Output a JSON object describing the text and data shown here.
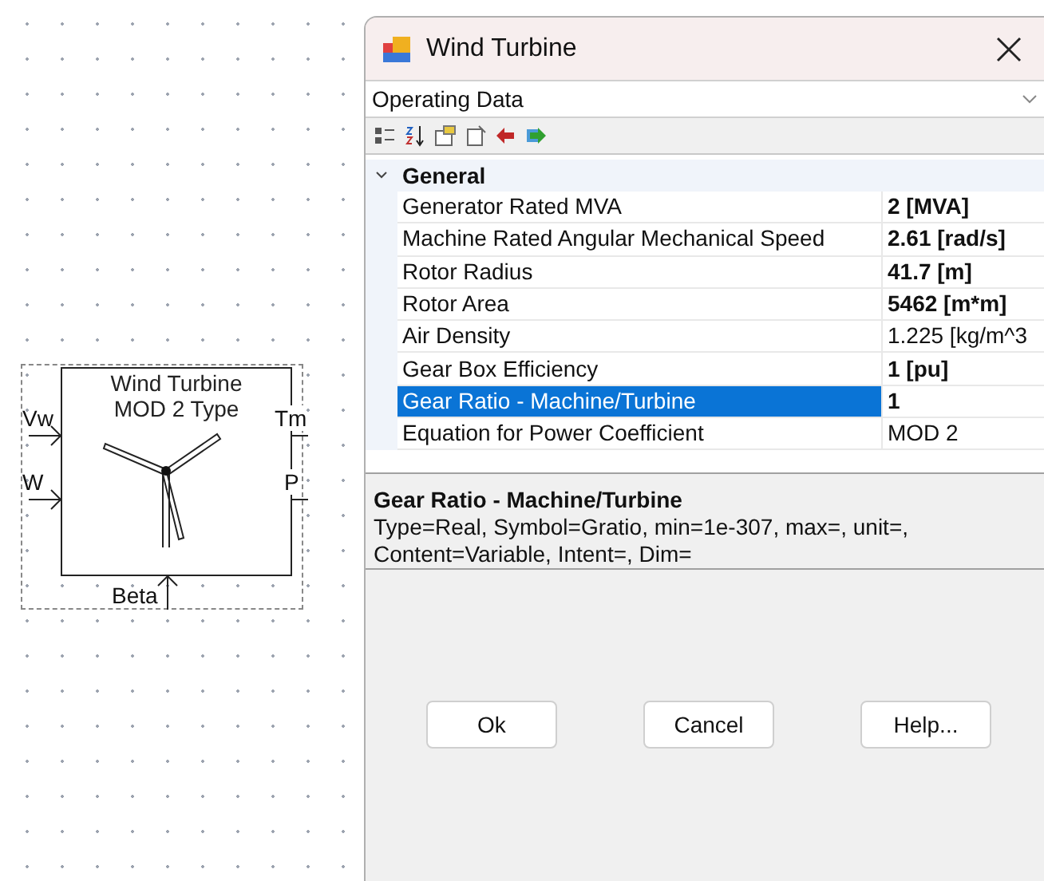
{
  "block": {
    "title_lines": [
      "Wind Turbine",
      "MOD 2 Type"
    ],
    "inputs": [
      "Vw",
      "W"
    ],
    "outputs": [
      "Tm",
      "P"
    ],
    "bottom_input": "Beta",
    "selected": true
  },
  "window": {
    "title": "Wind Turbine"
  },
  "category_select": {
    "value": "Operating Data"
  },
  "group": {
    "label": "General",
    "expanded": true
  },
  "properties": [
    {
      "name": "Generator Rated MVA",
      "value": "2 [MVA]",
      "bold": true,
      "selected": false
    },
    {
      "name": "Machine Rated Angular Mechanical Speed",
      "value": "2.61 [rad/s]",
      "bold": true,
      "selected": false
    },
    {
      "name": "Rotor Radius",
      "value": "41.7 [m]",
      "bold": true,
      "selected": false
    },
    {
      "name": "Rotor Area",
      "value": "5462 [m*m]",
      "bold": true,
      "selected": false
    },
    {
      "name": "Air Density",
      "value": "1.225 [kg/m^3",
      "bold": false,
      "selected": false
    },
    {
      "name": "Gear Box Efficiency",
      "value": "1 [pu]",
      "bold": true,
      "selected": false
    },
    {
      "name": "Gear Ratio - Machine/Turbine",
      "value": "1",
      "bold": true,
      "selected": true
    },
    {
      "name": "Equation for Power Coefficient",
      "value": "MOD 2",
      "bold": false,
      "selected": false
    }
  ],
  "description": {
    "title": "Gear Ratio - Machine/Turbine",
    "lines": [
      "Type=Real, Symbol=Gratio, min=1e-307, max=, unit=,",
      "Content=Variable, Intent=, Dim="
    ]
  },
  "buttons": [
    "Ok",
    "Cancel",
    "Help..."
  ]
}
